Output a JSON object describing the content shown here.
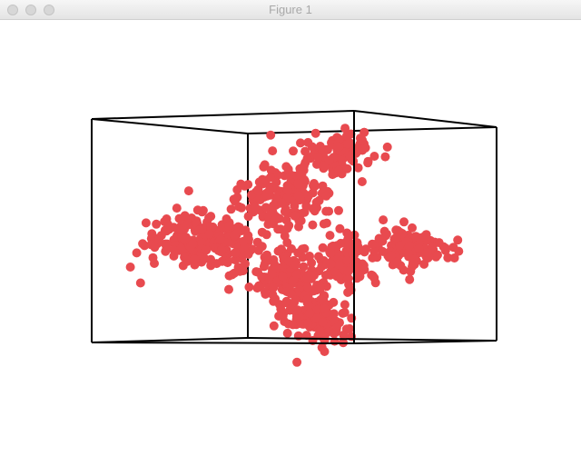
{
  "window": {
    "title": "Figure 1",
    "buttons": [
      "close",
      "minimize",
      "zoom"
    ]
  },
  "figure": {
    "type": "3d-scatter",
    "point_color": "#e84a4f",
    "box_color": "#000000",
    "axes_visible": false,
    "clusters": 8
  }
}
